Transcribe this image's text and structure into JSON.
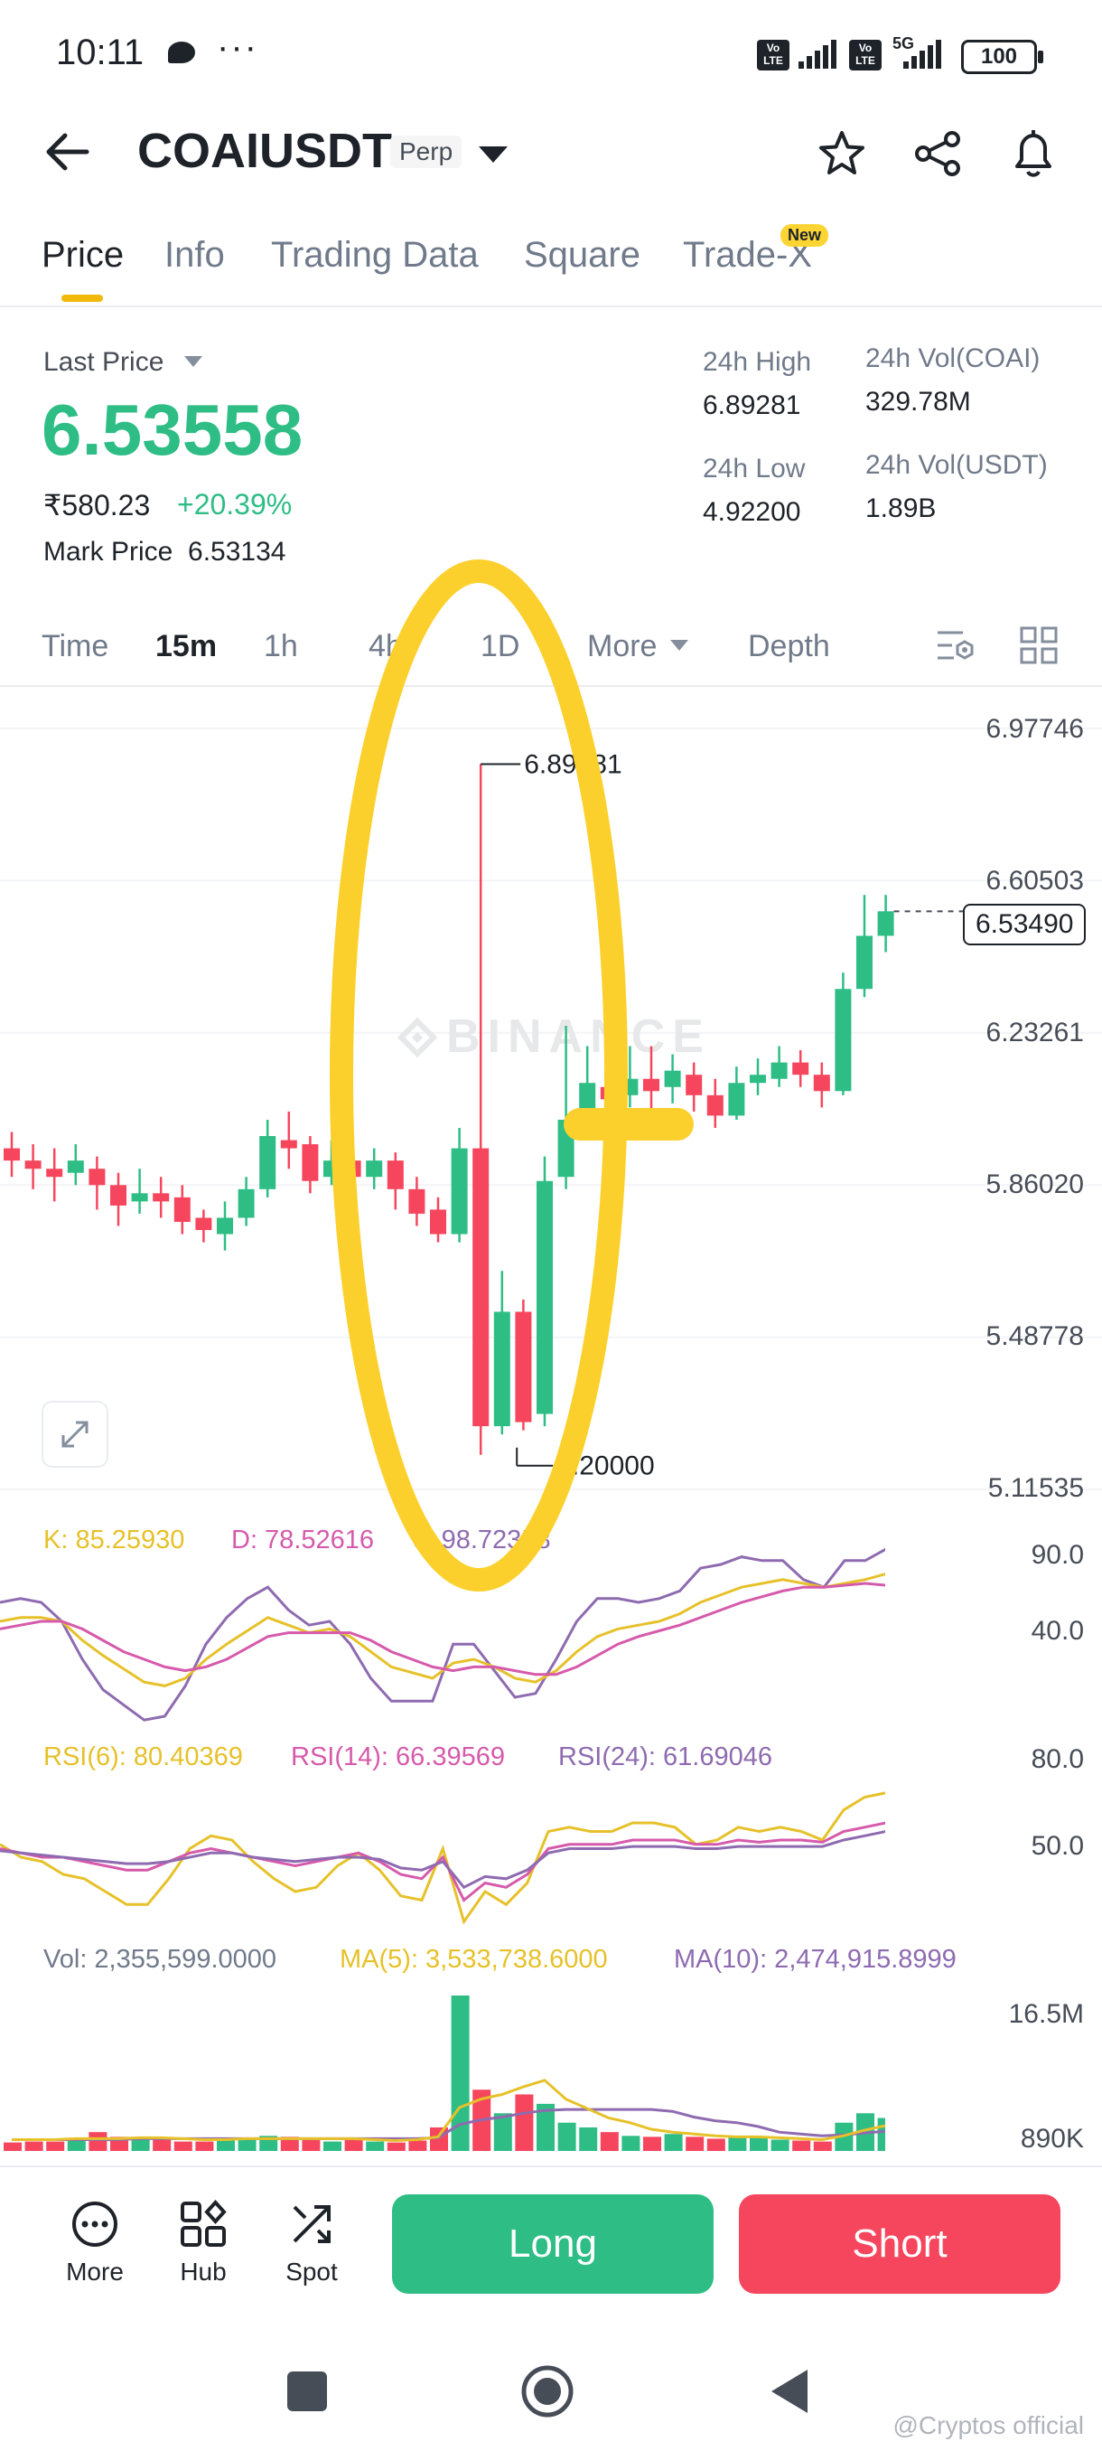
{
  "status_bar": {
    "time": "10:11",
    "dots": "···",
    "battery": "100",
    "volte": "Vo\nLTE",
    "network": "5G"
  },
  "header": {
    "title": "COAIUSDT",
    "badge": "Perp"
  },
  "tabs": [
    {
      "label": "Price"
    },
    {
      "label": "Info"
    },
    {
      "label": "Trading Data"
    },
    {
      "label": "Square"
    },
    {
      "label": "Trade-X"
    }
  ],
  "new_badge": "New",
  "summary": {
    "last_price_label": "Last Price",
    "last_price": "6.53558",
    "inr_price": "₹580.23",
    "change": "+20.39%",
    "mark_price_label": "Mark Price",
    "mark_price": "6.53134",
    "high_label": "24h High",
    "high": "6.89281",
    "low_label": "24h Low",
    "low": "4.92200",
    "vol_coai_label": "24h Vol(COAI)",
    "vol_coai": "329.78M",
    "vol_usdt_label": "24h Vol(USDT)",
    "vol_usdt": "1.89B"
  },
  "timeframes": [
    {
      "label": "Time"
    },
    {
      "label": "15m"
    },
    {
      "label": "1h"
    },
    {
      "label": "4h"
    },
    {
      "label": "1D"
    },
    {
      "label": "More"
    },
    {
      "label": "Depth"
    }
  ],
  "chart_data": {
    "type": "candlestick",
    "price_axis": [
      "6.97746",
      "6.60503",
      "6.23261",
      "5.86020",
      "5.48778",
      "5.11535"
    ],
    "current_price_tag": "6.53490",
    "high_marker": "6.89281",
    "low_marker": "5.20000",
    "watermark": "BINANCE",
    "candles": [
      {
        "o": 5.95,
        "c": 5.92,
        "h": 5.99,
        "l": 5.88
      },
      {
        "o": 5.92,
        "c": 5.9,
        "h": 5.96,
        "l": 5.85
      },
      {
        "o": 5.9,
        "c": 5.88,
        "h": 5.95,
        "l": 5.82
      },
      {
        "o": 5.89,
        "c": 5.92,
        "h": 5.96,
        "l": 5.86
      },
      {
        "o": 5.9,
        "c": 5.86,
        "h": 5.93,
        "l": 5.8
      },
      {
        "o": 5.86,
        "c": 5.81,
        "h": 5.89,
        "l": 5.76
      },
      {
        "o": 5.82,
        "c": 5.84,
        "h": 5.9,
        "l": 5.79
      },
      {
        "o": 5.84,
        "c": 5.82,
        "h": 5.88,
        "l": 5.78
      },
      {
        "o": 5.83,
        "c": 5.77,
        "h": 5.86,
        "l": 5.74
      },
      {
        "o": 5.78,
        "c": 5.75,
        "h": 5.8,
        "l": 5.72
      },
      {
        "o": 5.74,
        "c": 5.78,
        "h": 5.82,
        "l": 5.7
      },
      {
        "o": 5.78,
        "c": 5.85,
        "h": 5.88,
        "l": 5.76
      },
      {
        "o": 5.85,
        "c": 5.98,
        "h": 6.02,
        "l": 5.83
      },
      {
        "o": 5.97,
        "c": 5.95,
        "h": 6.04,
        "l": 5.9
      },
      {
        "o": 5.96,
        "c": 5.87,
        "h": 5.98,
        "l": 5.84
      },
      {
        "o": 5.88,
        "c": 5.92,
        "h": 5.97,
        "l": 5.86
      },
      {
        "o": 5.92,
        "c": 5.88,
        "h": 5.96,
        "l": 5.84
      },
      {
        "o": 5.88,
        "c": 5.92,
        "h": 5.95,
        "l": 5.85
      },
      {
        "o": 5.92,
        "c": 5.85,
        "h": 5.94,
        "l": 5.8
      },
      {
        "o": 5.85,
        "c": 5.79,
        "h": 5.88,
        "l": 5.76
      },
      {
        "o": 5.8,
        "c": 5.74,
        "h": 5.83,
        "l": 5.72
      },
      {
        "o": 5.74,
        "c": 5.95,
        "h": 6.0,
        "l": 5.72
      },
      {
        "o": 5.95,
        "c": 5.27,
        "h": 6.89,
        "l": 5.2
      },
      {
        "o": 5.27,
        "c": 5.55,
        "h": 5.65,
        "l": 5.25
      },
      {
        "o": 5.55,
        "c": 5.28,
        "h": 5.58,
        "l": 5.26
      },
      {
        "o": 5.3,
        "c": 5.87,
        "h": 5.93,
        "l": 5.27
      },
      {
        "o": 5.88,
        "c": 6.02,
        "h": 6.25,
        "l": 5.85
      },
      {
        "o": 6.01,
        "c": 6.11,
        "h": 6.2,
        "l": 5.98
      },
      {
        "o": 6.1,
        "c": 6.07,
        "h": 6.22,
        "l": 6.03
      },
      {
        "o": 6.08,
        "c": 6.12,
        "h": 6.2,
        "l": 6.05
      },
      {
        "o": 6.12,
        "c": 6.09,
        "h": 6.2,
        "l": 6.04
      },
      {
        "o": 6.1,
        "c": 6.14,
        "h": 6.18,
        "l": 6.06
      },
      {
        "o": 6.13,
        "c": 6.08,
        "h": 6.16,
        "l": 6.04
      },
      {
        "o": 6.08,
        "c": 6.03,
        "h": 6.12,
        "l": 6.0
      },
      {
        "o": 6.03,
        "c": 6.11,
        "h": 6.15,
        "l": 6.02
      },
      {
        "o": 6.11,
        "c": 6.13,
        "h": 6.17,
        "l": 6.08
      },
      {
        "o": 6.12,
        "c": 6.16,
        "h": 6.2,
        "l": 6.1
      },
      {
        "o": 6.16,
        "c": 6.13,
        "h": 6.19,
        "l": 6.1
      },
      {
        "o": 6.13,
        "c": 6.09,
        "h": 6.16,
        "l": 6.05
      },
      {
        "o": 6.09,
        "c": 6.34,
        "h": 6.38,
        "l": 6.08
      },
      {
        "o": 6.34,
        "c": 6.47,
        "h": 6.57,
        "l": 6.32
      },
      {
        "o": 6.47,
        "c": 6.53,
        "h": 6.57,
        "l": 6.43
      }
    ],
    "y_min": 5.11535,
    "y_max": 6.97746
  },
  "kdj": {
    "k": "K: 85.25930",
    "d": "D: 78.52616",
    "j": "J: 98.72358",
    "axis": [
      "90.0",
      "40.0"
    ],
    "k_values": [
      60,
      62,
      62,
      60,
      50,
      42,
      35,
      28,
      26,
      30,
      40,
      48,
      55,
      62,
      58,
      54,
      56,
      52,
      44,
      36,
      33,
      30,
      38,
      40,
      36,
      30,
      28,
      34,
      44,
      52,
      56,
      58,
      60,
      64,
      70,
      74,
      78,
      80,
      82,
      80,
      78,
      80,
      82,
      85
    ],
    "d_values": [
      56,
      58,
      60,
      60,
      56,
      50,
      44,
      40,
      36,
      34,
      36,
      40,
      46,
      52,
      54,
      54,
      54,
      54,
      50,
      44,
      40,
      36,
      34,
      36,
      36,
      34,
      32,
      32,
      36,
      42,
      48,
      52,
      55,
      58,
      62,
      66,
      70,
      73,
      76,
      78,
      78,
      79,
      80,
      79
    ],
    "j_values": [
      70,
      72,
      70,
      60,
      40,
      24,
      16,
      8,
      10,
      26,
      48,
      62,
      72,
      78,
      66,
      58,
      60,
      48,
      30,
      18,
      18,
      18,
      48,
      48,
      34,
      20,
      22,
      40,
      60,
      72,
      72,
      70,
      72,
      76,
      88,
      90,
      94,
      92,
      92,
      82,
      78,
      92,
      92,
      98
    ]
  },
  "rsi": {
    "rsi6": "RSI(6): 80.40369",
    "rsi14": "RSI(14): 66.39569",
    "rsi24": "RSI(24): 61.69046",
    "axis": [
      "80.0",
      "50.0"
    ],
    "rsi6_values": [
      56,
      50,
      48,
      42,
      40,
      34,
      28,
      28,
      40,
      54,
      60,
      58,
      48,
      40,
      34,
      36,
      46,
      52,
      44,
      32,
      30,
      54,
      20,
      34,
      28,
      38,
      62,
      64,
      62,
      62,
      66,
      66,
      64,
      56,
      58,
      64,
      62,
      64,
      62,
      58,
      72,
      78,
      80
    ],
    "rsi14_values": [
      54,
      52,
      50,
      50,
      48,
      46,
      44,
      44,
      48,
      52,
      54,
      52,
      50,
      48,
      46,
      48,
      50,
      52,
      48,
      42,
      40,
      50,
      30,
      38,
      36,
      42,
      54,
      56,
      56,
      56,
      58,
      58,
      58,
      56,
      56,
      58,
      57,
      58,
      58,
      57,
      62,
      64,
      66
    ],
    "rsi24_values": [
      53,
      52,
      51,
      50,
      49,
      48,
      47,
      47,
      48,
      50,
      52,
      52,
      50,
      49,
      48,
      49,
      50,
      50,
      49,
      45,
      44,
      48,
      36,
      41,
      40,
      44,
      52,
      54,
      54,
      54,
      55,
      55,
      55,
      54,
      54,
      55,
      55,
      55,
      55,
      55,
      58,
      60,
      62
    ]
  },
  "volume": {
    "vol": "Vol: 2,355,599.0000",
    "ma5": "MA(5): 3,533,738.6000",
    "ma10": "MA(10): 2,474,915.8999",
    "axis": [
      "16.5M",
      "890K"
    ],
    "values": [
      0.9,
      1.0,
      1.0,
      1.2,
      2.0,
      1.5,
      1.2,
      1.3,
      1.0,
      1.0,
      1.4,
      1.2,
      1.6,
      1.5,
      1.2,
      1.0,
      1.2,
      1.0,
      0.9,
      1.1,
      2.5,
      16.5,
      6.5,
      4.0,
      6.0,
      5.0,
      3.0,
      2.5,
      2.0,
      1.6,
      1.5,
      1.8,
      1.5,
      1.3,
      1.5,
      1.4,
      1.2,
      1.1,
      1.0,
      3.0,
      4.0,
      3.5,
      2.3
    ],
    "ma5_values": [
      1.2,
      1.2,
      1.2,
      1.3,
      1.3,
      1.3,
      1.4,
      1.4,
      1.3,
      1.2,
      1.2,
      1.3,
      1.3,
      1.3,
      1.3,
      1.3,
      1.3,
      1.2,
      1.1,
      1.2,
      1.5,
      4.6,
      5.5,
      6.0,
      6.8,
      7.5,
      5.5,
      4.5,
      3.5,
      3.0,
      2.3,
      2.0,
      1.8,
      1.6,
      1.5,
      1.5,
      1.4,
      1.3,
      1.2,
      1.6,
      2.2,
      2.7,
      3.5
    ],
    "ma10_values": [
      1.2,
      1.2,
      1.2,
      1.2,
      1.2,
      1.2,
      1.3,
      1.3,
      1.3,
      1.3,
      1.3,
      1.3,
      1.3,
      1.3,
      1.3,
      1.3,
      1.3,
      1.3,
      1.3,
      1.3,
      1.4,
      2.8,
      3.3,
      3.6,
      4.0,
      4.3,
      4.4,
      4.4,
      4.4,
      4.4,
      4.4,
      4.2,
      3.6,
      3.2,
      3.0,
      2.6,
      2.0,
      1.8,
      1.6,
      1.7,
      1.9,
      2.1,
      2.5
    ]
  },
  "bottom": {
    "more": "More",
    "hub": "Hub",
    "spot": "Spot",
    "long": "Long",
    "short": "Short"
  },
  "watermark_text": "@Cryptos official",
  "colors": {
    "green": "#2ebd85",
    "red": "#f6465d",
    "yellow": "#f0b90b",
    "annotation": "#fcd02c",
    "purple": "#8e6bb0",
    "magenta": "#d65aab",
    "gold": "#e6c12a"
  }
}
